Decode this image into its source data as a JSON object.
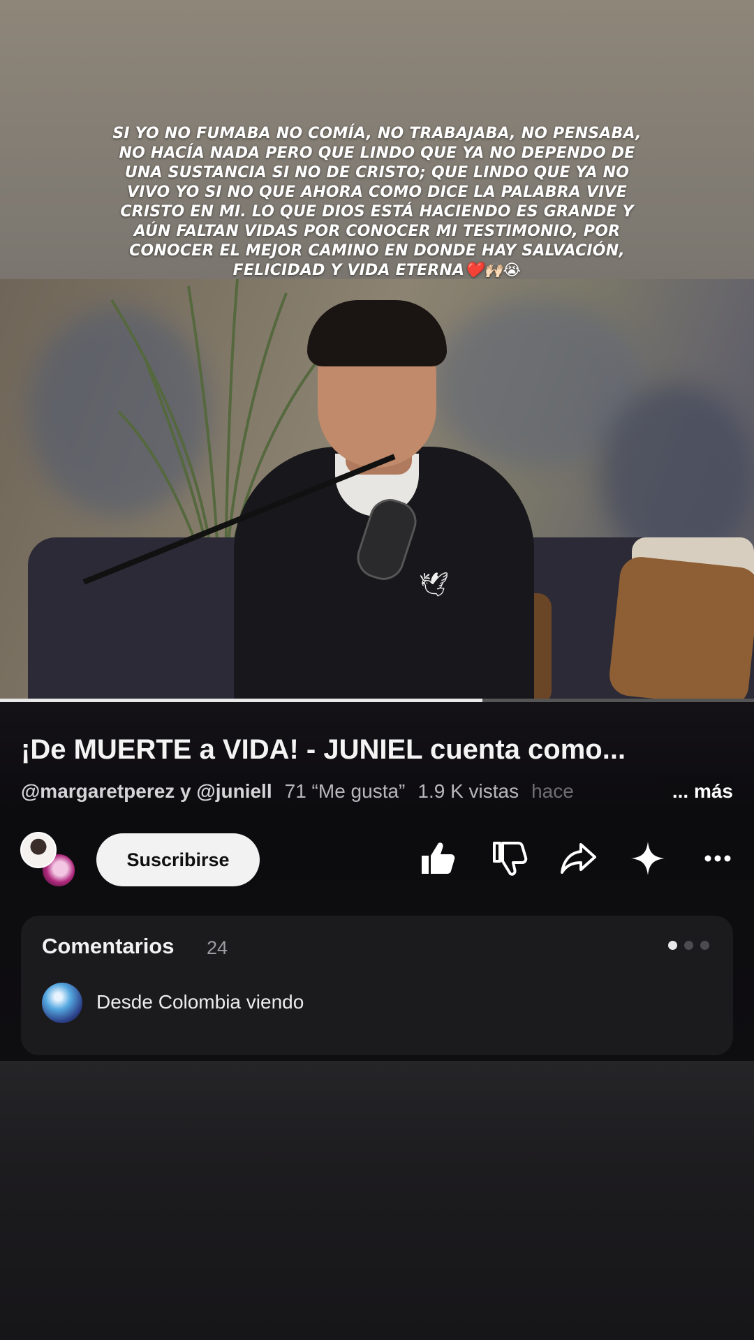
{
  "story": {
    "caption": "SI YO NO FUMABA NO COMÍA, NO TRABAJABA, NO PENSABA, NO HACÍA NADA PERO QUE LINDO QUE YA NO DEPENDO DE UNA SUSTANCIA SI NO DE CRISTO; QUE LINDO QUE YA NO VIVO YO SI NO QUE AHORA COMO DICE LA PALABRA VIVE CRISTO EN MI.  LO QUE DIOS ESTÁ HACIENDO ES GRANDE Y AÚN FALTAN VIDAS POR CONOCER MI TESTIMONIO, POR CONOCER EL MEJOR CAMINO EN DONDE HAY SALVACIÓN, FELICIDAD Y VIDA ETERNA❤️🙌🏻😭"
  },
  "video": {
    "progress_fraction": 0.64,
    "icons": [
      "bird-logo-icon",
      "microphone-icon"
    ]
  },
  "details": {
    "title": "¡De MUERTE a VIDA! - JUNIEL cuenta como...",
    "channels": "@margaretperez y @juniell",
    "likes": "71 “Me gusta”",
    "views": "1.9 K vistas",
    "time": "hace",
    "more": "... más"
  },
  "actions": {
    "subscribe_label": "Suscribirse",
    "icons": [
      "thumbs-up-icon",
      "thumbs-down-icon",
      "share-icon",
      "sparkle-icon",
      "more-icon"
    ]
  },
  "comments": {
    "title": "Comentarios",
    "count": "24",
    "first_comment": "Desde Colombia viendo",
    "pager_active_index": 0,
    "pager_total": 3
  },
  "colors": {
    "panel_bg": "#0d0c0f",
    "card_bg": "#1b1a1d",
    "button_bg": "#f2f2f2",
    "text_primary": "#f4f4f4",
    "text_secondary": "#b8b8bc"
  }
}
